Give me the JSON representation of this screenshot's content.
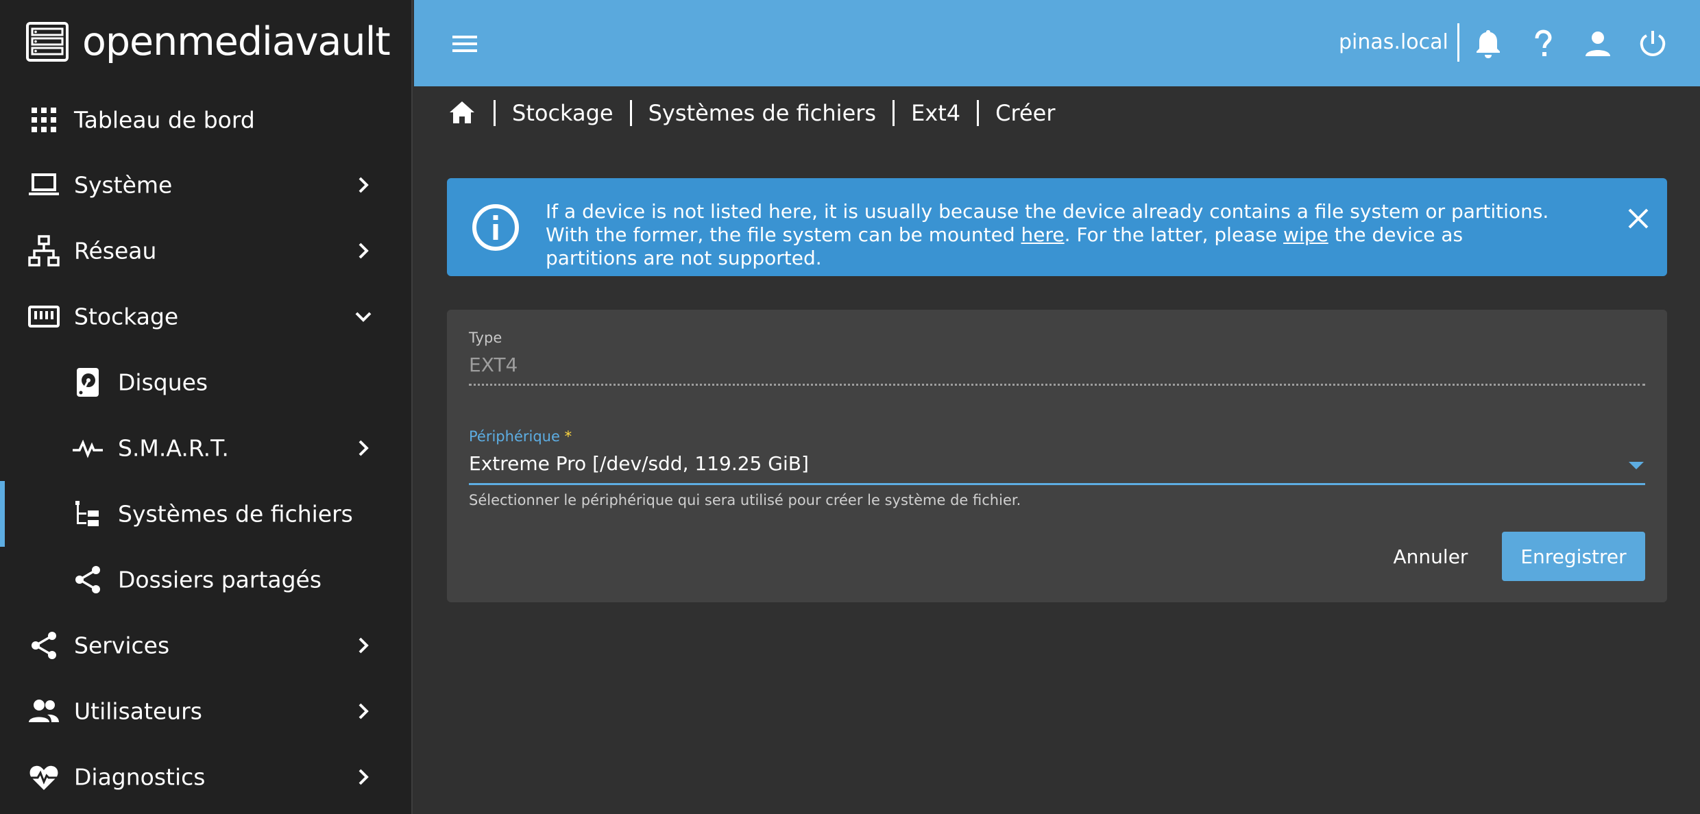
{
  "app": {
    "name": "openmediavault"
  },
  "header": {
    "hostname": "pinas.local"
  },
  "sidebar": {
    "items": [
      {
        "label": "Tableau de bord",
        "icon": "dashboard-grid-icon"
      },
      {
        "label": "Système",
        "icon": "laptop-icon",
        "expandable": true,
        "expanded": false
      },
      {
        "label": "Réseau",
        "icon": "network-icon",
        "expandable": true,
        "expanded": false
      },
      {
        "label": "Stockage",
        "icon": "storage-icon",
        "expandable": true,
        "expanded": true
      },
      {
        "label": "Disques",
        "icon": "harddisk-icon",
        "sub": true
      },
      {
        "label": "S.M.A.R.T.",
        "icon": "pulse-icon",
        "sub": true,
        "expandable": true
      },
      {
        "label": "Systèmes de fichiers",
        "icon": "file-tree-icon",
        "sub": true,
        "active": true
      },
      {
        "label": "Dossiers partagés",
        "icon": "share-icon",
        "sub": true
      },
      {
        "label": "Services",
        "icon": "share-icon",
        "expandable": true,
        "expanded": false
      },
      {
        "label": "Utilisateurs",
        "icon": "users-icon",
        "expandable": true,
        "expanded": false
      },
      {
        "label": "Diagnostics",
        "icon": "heart-pulse-icon",
        "expandable": true,
        "expanded": false
      }
    ]
  },
  "breadcrumb": [
    "Stockage",
    "Systèmes de fichiers",
    "Ext4",
    "Créer"
  ],
  "alert": {
    "text_1": "If a device is not listed here, it is usually because the device already contains a file system or partitions. With the former, the file system can be mounted ",
    "link_here": "here",
    "text_2": ". For the latter, please ",
    "link_wipe": "wipe",
    "text_3": " the device as partitions are not supported."
  },
  "form": {
    "type_label": "Type",
    "type_value": "EXT4",
    "device_label": "Périphérique",
    "device_required_mark": "*",
    "device_value": "Extreme Pro [/dev/sdd, 119.25 GiB]",
    "device_hint": "Sélectionner le périphérique qui sera utilisé pour créer le système de fichier.",
    "cancel_label": "Annuler",
    "save_label": "Enregistrer"
  },
  "colors": {
    "accent": "#5aa9dd",
    "alert_bg": "#3a93d2",
    "sidebar_bg": "#212121",
    "content_bg": "#303030",
    "card_bg": "#424242",
    "required": "#ffd740"
  }
}
